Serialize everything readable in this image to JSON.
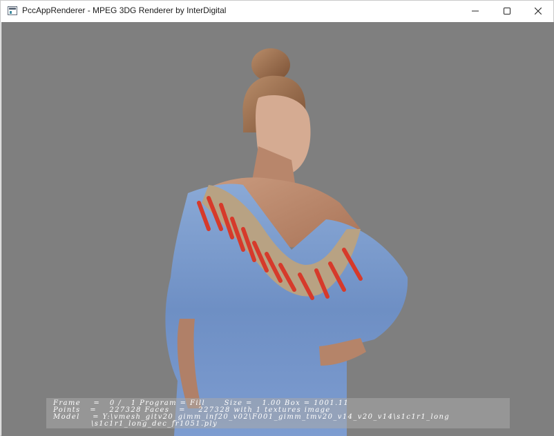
{
  "window": {
    "title": "PccAppRenderer - MPEG 3DG Renderer by InterDigital",
    "icon": "app-window-icon",
    "controls": {
      "minimize": "minimize-icon",
      "maximize": "maximize-icon",
      "close": "close-icon"
    }
  },
  "viewport": {
    "background": "#7f7f7f",
    "model_icon": "3d-point-cloud-person"
  },
  "overlay": {
    "line1": "Frame    =   0 /   1 Program = Fill      Size =   1.00 Box = 1001.11",
    "line2": "Points   =    227328 Faces   =    227328 with 1 textures image",
    "line3": "Model    = Y:\\vmesh_gitv20_gimm_inf20_v02\\F001_gimm_tmv20_v14_v20_v14\\s1c1r1_long",
    "line4": "            \\s1c1r1_long_dec_fr1051.ply"
  }
}
